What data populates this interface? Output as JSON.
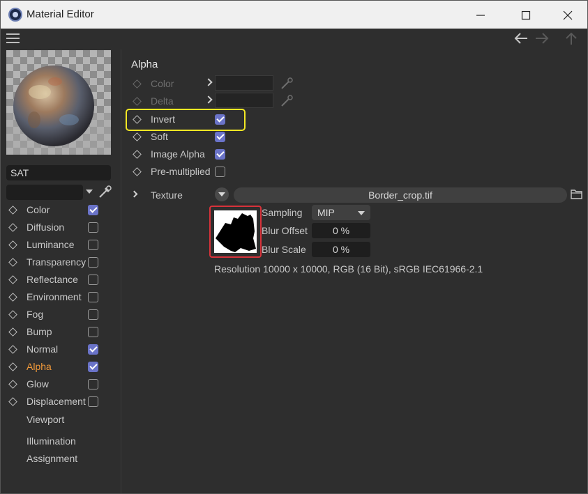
{
  "window": {
    "title": "Material Editor",
    "minimize_glyph": "—",
    "maximize_glyph": "☐",
    "close_glyph": "✕"
  },
  "toolbar": {
    "menu_icon": "hamburger-menu-icon",
    "back_icon": "arrow-left-icon",
    "forward_icon": "arrow-right-icon",
    "up_icon": "arrow-up-icon"
  },
  "material": {
    "name": "SAT",
    "search_value": ""
  },
  "channels": [
    {
      "label": "Color",
      "checked": true,
      "active": false
    },
    {
      "label": "Diffusion",
      "checked": false,
      "active": false
    },
    {
      "label": "Luminance",
      "checked": false,
      "active": false
    },
    {
      "label": "Transparency",
      "checked": false,
      "active": false
    },
    {
      "label": "Reflectance",
      "checked": false,
      "active": false
    },
    {
      "label": "Environment",
      "checked": false,
      "active": false
    },
    {
      "label": "Fog",
      "checked": false,
      "active": false
    },
    {
      "label": "Bump",
      "checked": false,
      "active": false
    },
    {
      "label": "Normal",
      "checked": true,
      "active": false
    },
    {
      "label": "Alpha",
      "checked": true,
      "active": true
    },
    {
      "label": "Glow",
      "checked": false,
      "active": false
    },
    {
      "label": "Displacement",
      "checked": false,
      "active": false
    }
  ],
  "extra_items": [
    "Viewport",
    "Illumination",
    "Assignment"
  ],
  "section": {
    "title": "Alpha",
    "color_label": "Color",
    "delta_label": "Delta",
    "options": [
      {
        "label": "Invert",
        "checked": true
      },
      {
        "label": "Soft",
        "checked": true
      },
      {
        "label": "Image Alpha",
        "checked": true
      },
      {
        "label": "Pre-multiplied",
        "checked": false
      }
    ]
  },
  "texture": {
    "label": "Texture",
    "file": "Border_crop.tif",
    "sampling_label": "Sampling",
    "sampling_value": "MIP",
    "blur_offset_label": "Blur Offset",
    "blur_offset_value": "0 %",
    "blur_scale_label": "Blur Scale",
    "blur_scale_value": "0 %",
    "resolution": "Resolution 10000 x 10000, RGB (16 Bit), sRGB IEC61966-2.1"
  },
  "colors": {
    "checkbox_checked": "#6a73c8",
    "active_channel": "#f29a3a",
    "invert_highlight": "#f3e824",
    "thumbnail_highlight": "#d8323a"
  }
}
